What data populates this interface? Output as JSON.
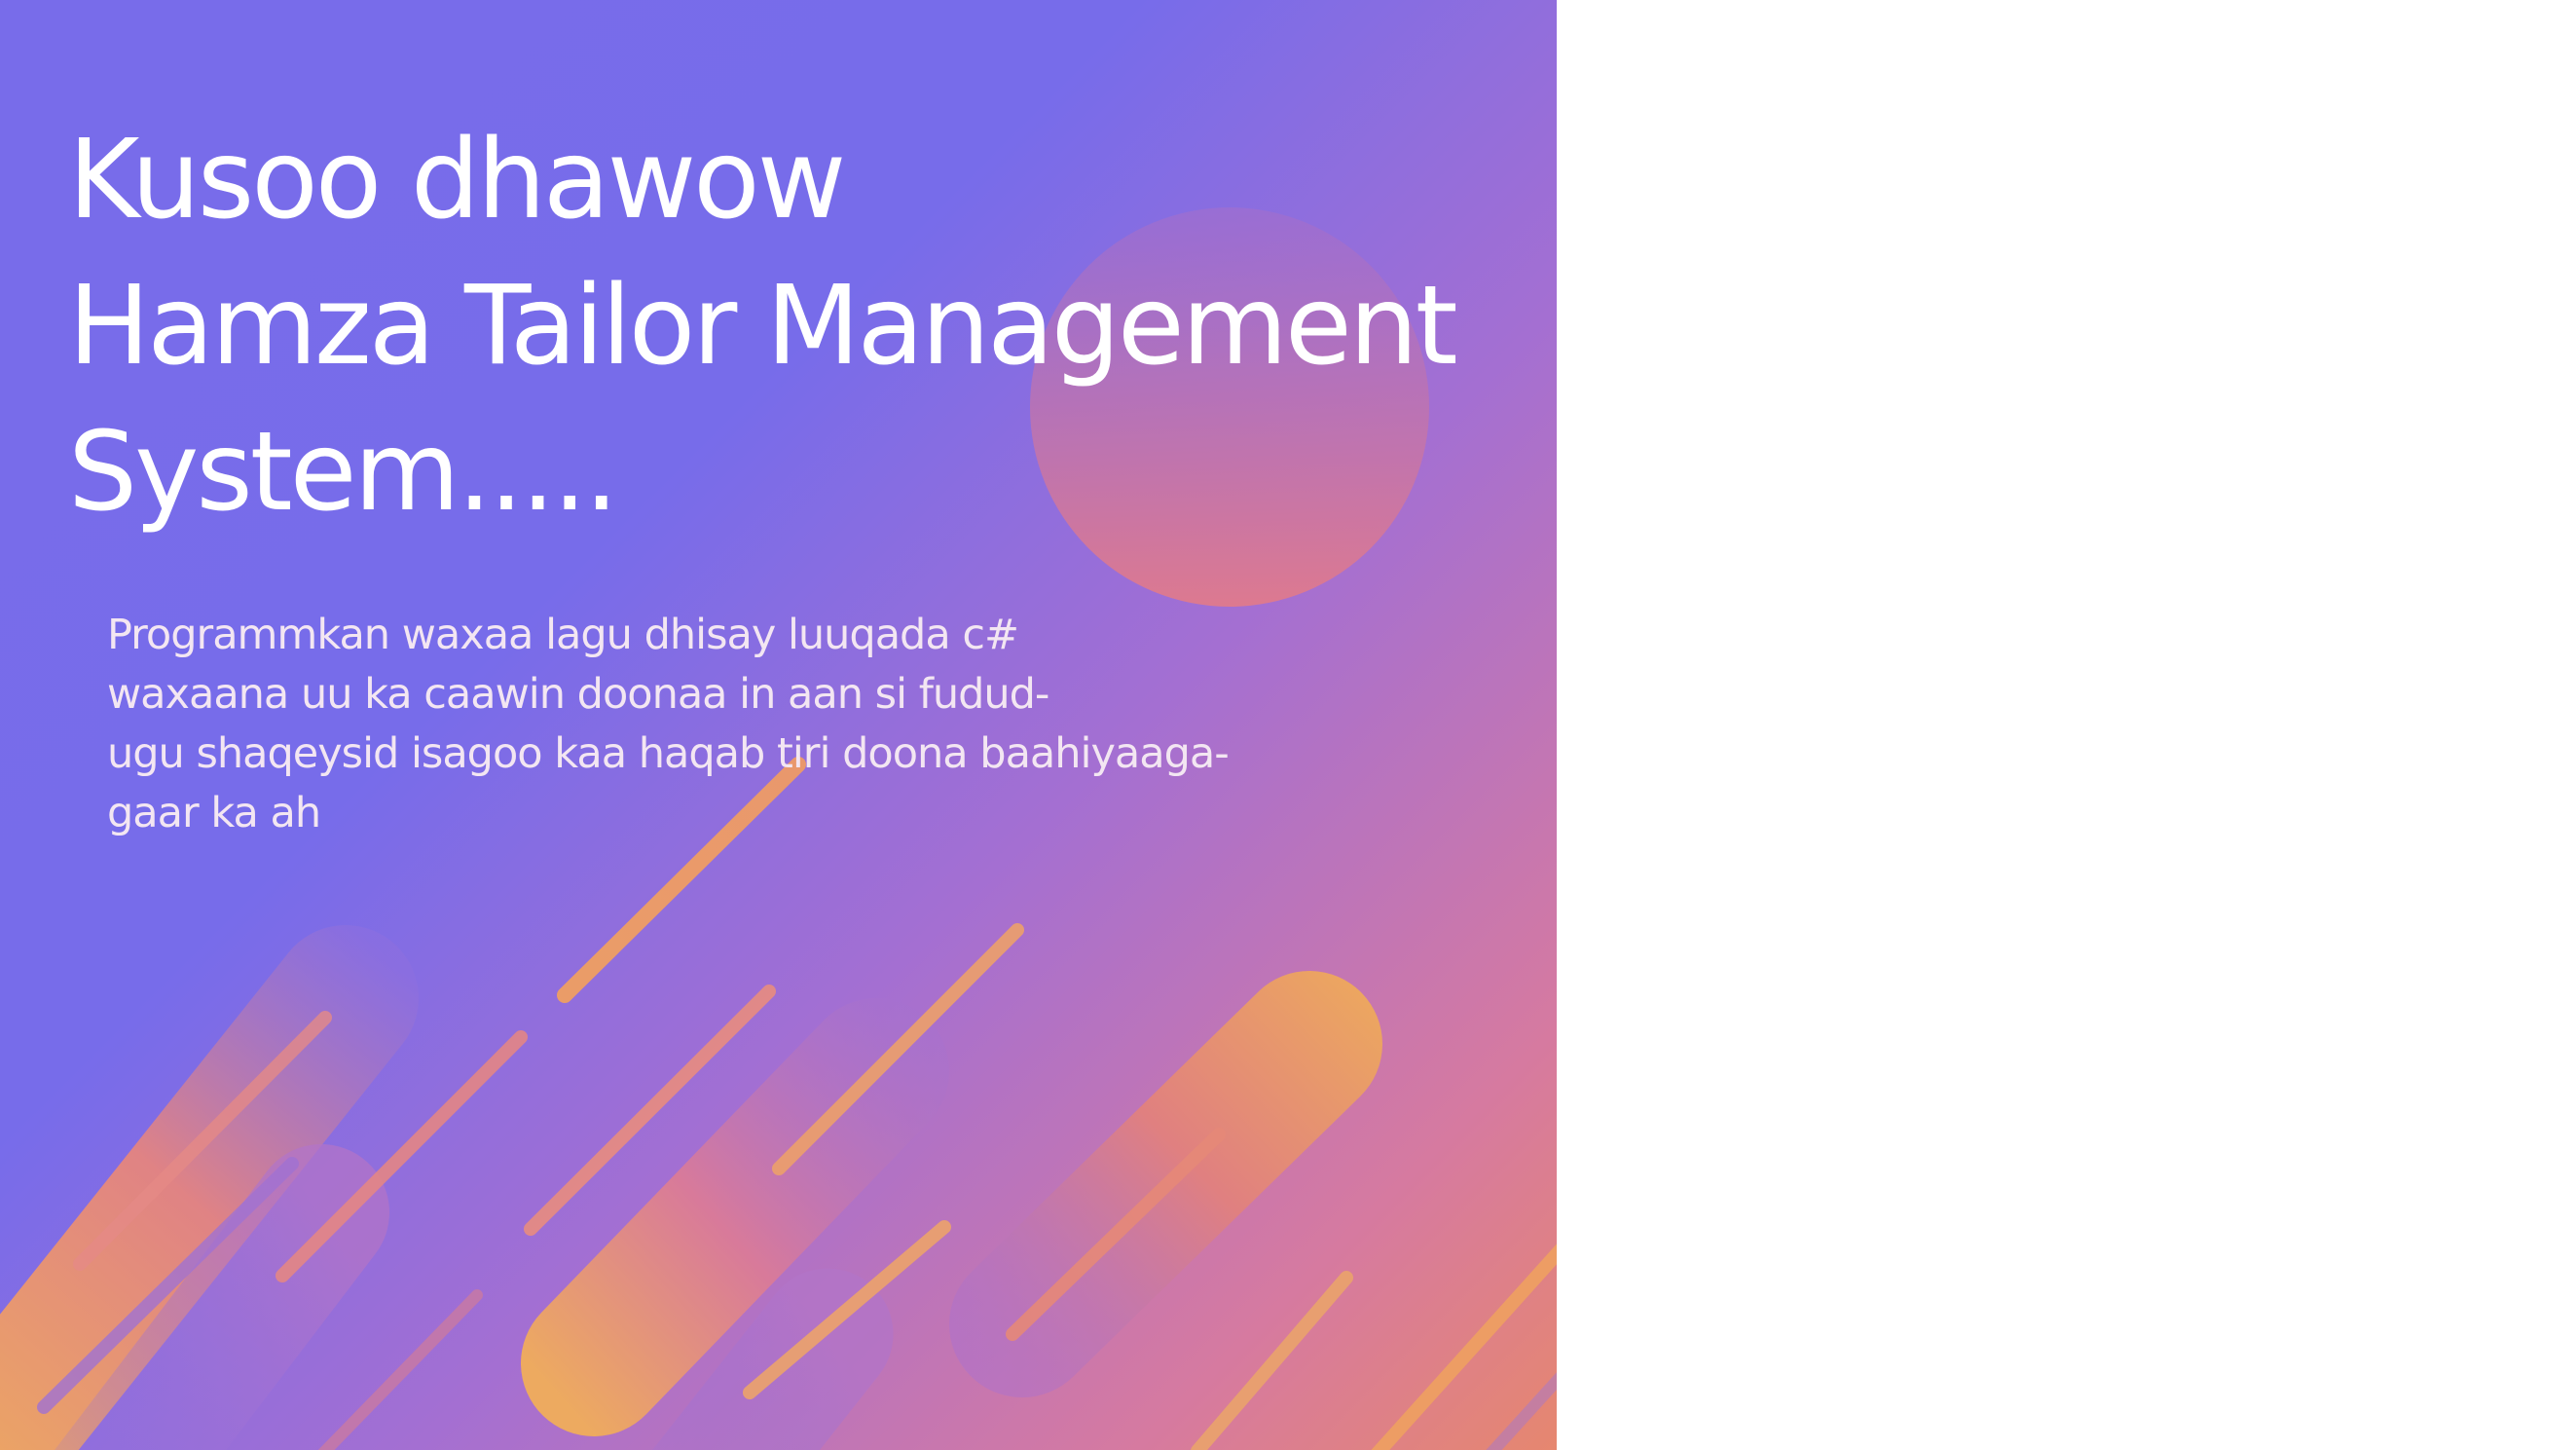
{
  "slide": {
    "title_lines": [
      "Kusoo dhawow",
      "Hamza Tailor Management",
      "System....."
    ],
    "description_lines": [
      "Programmkan waxaa lagu dhisay luuqada c#",
      "waxaana uu ka caawin doonaa in aan si fudud-",
      "ugu shaqeysid isagoo kaa haqab tiri doona baahiyaaga-",
      "gaar ka ah"
    ]
  },
  "colors": {
    "gradient_start": "#786cea",
    "gradient_mid": "#a46fd2",
    "gradient_end": "#e6876f",
    "accent_orange": "#eeab5f",
    "accent_pink": "#e57f83",
    "text_primary": "#ffffff",
    "text_secondary": "#f3e6f2"
  }
}
